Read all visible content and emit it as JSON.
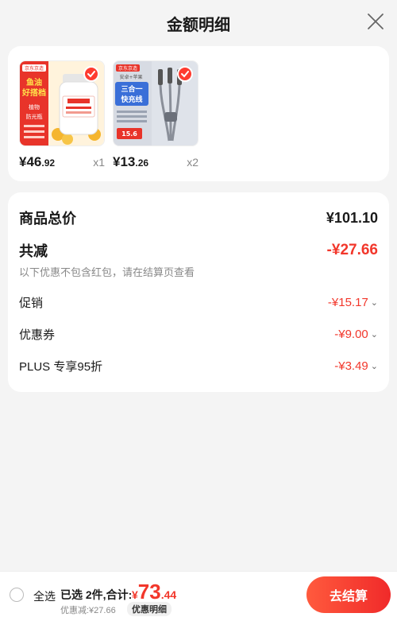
{
  "header": {
    "title": "金额明细",
    "close_icon": "close-icon"
  },
  "products": [
    {
      "price_int": "¥46",
      "price_dec": ".92",
      "qty": "x1",
      "thumb": {
        "badge": "京东京造",
        "headline": "鱼油",
        "tagline": "好搭档",
        "lines": [
          "植物",
          "防光瓶"
        ]
      }
    },
    {
      "price_int": "¥13",
      "price_dec": ".26",
      "qty": "x2",
      "thumb": {
        "badge": "京东京造",
        "tag": "安卓+苹果",
        "headline": "三合一",
        "tagline": "快充线",
        "price_sticker": "15.6"
      }
    }
  ],
  "summary": {
    "total_label": "商品总价",
    "total_value": "¥101.10",
    "reduce_label": "共减",
    "reduce_value": "-¥27.66",
    "reduce_note": "以下优惠不包含红包，请在结算页查看",
    "items": [
      {
        "label": "促销",
        "value": "-¥15.17"
      },
      {
        "label": "优惠券",
        "value": "-¥9.00"
      },
      {
        "label": "PLUS 专享95折",
        "value": "-¥3.49"
      }
    ]
  },
  "bottom_bar": {
    "select_all": "全选",
    "selected_text": "已选 2件,合计:",
    "total_currency": "¥",
    "total_int": "73",
    "total_dec": ".44",
    "discount_line": "优惠减:¥27.66",
    "detail_tag": "优惠明细",
    "checkout": "去结算"
  },
  "colors": {
    "accent": "#f2372b",
    "background": "#f4f4f4"
  }
}
